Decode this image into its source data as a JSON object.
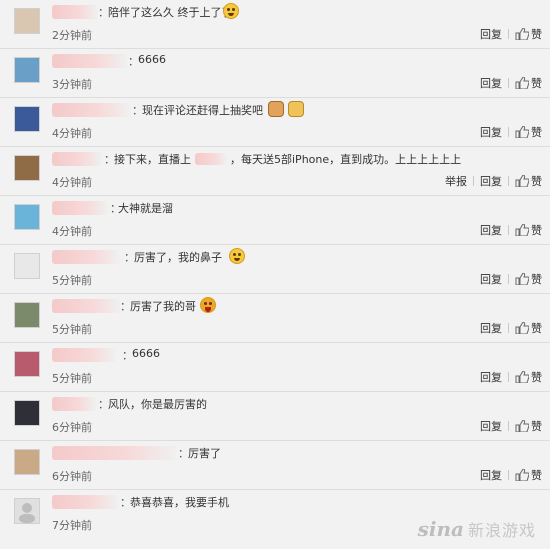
{
  "comments": [
    {
      "text": "陪伴了这么久 终于上了了",
      "time": "2分钟前",
      "reply": "回复",
      "like": "赞",
      "avatar_color": "#d9c7b1",
      "emoji": "smiley"
    },
    {
      "text": "6666",
      "time": "3分钟前",
      "reply": "回复",
      "like": "赞",
      "avatar_color": "#6aa0c8"
    },
    {
      "text": "现在评论还赶得上抽奖吧",
      "time": "4分钟前",
      "reply": "回复",
      "like": "赞",
      "avatar_color": "#3a5a9a",
      "emoji": "dogs"
    },
    {
      "text": "接下来，直播上",
      "text2": "，每天送5部iPhone，直到成功。上上上上上上",
      "time": "4分钟前",
      "report": "举报",
      "reply": "回复",
      "like": "赞",
      "avatar_color": "#8f6c45"
    },
    {
      "text": "大神就是溜",
      "time": "4分钟前",
      "reply": "回复",
      "like": "赞",
      "avatar_color": "#69b4d8"
    },
    {
      "text": "厉害了，我的鼻子",
      "time": "5分钟前",
      "reply": "回复",
      "like": "赞",
      "avatar_color": "#e8e8e8",
      "emoji": "smiley"
    },
    {
      "text": "厉害了我的哥",
      "time": "5分钟前",
      "reply": "回复",
      "like": "赞",
      "avatar_color": "#7b8a6a",
      "emoji": "laugh"
    },
    {
      "text": "6666",
      "time": "5分钟前",
      "reply": "回复",
      "like": "赞",
      "avatar_color": "#b85c6d"
    },
    {
      "text": "风队，你是最厉害的",
      "time": "6分钟前",
      "reply": "回复",
      "like": "赞",
      "avatar_color": "#2f2f3a"
    },
    {
      "text": "厉害了",
      "time": "6分钟前",
      "reply": "回复",
      "like": "赞",
      "avatar_color": "#c9a986"
    },
    {
      "text": "恭喜恭喜，我要手机",
      "time": "7分钟前",
      "reply": "回复",
      "like": "赞",
      "avatar_color": "#e0e0e0"
    }
  ],
  "watermark": {
    "logo": "sina",
    "text": "新浪游戏"
  }
}
